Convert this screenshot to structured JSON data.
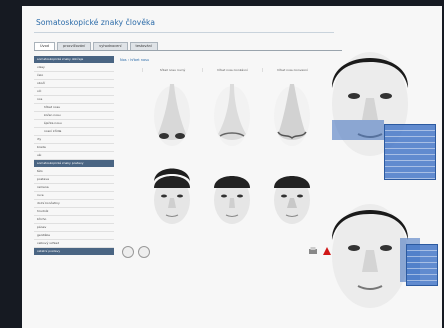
{
  "app": {
    "title": "Somatoskopické znaky člověka"
  },
  "tabs": [
    {
      "label": "Úvod"
    },
    {
      "label": "procvičování"
    },
    {
      "label": "vyhodnocení"
    },
    {
      "label": "testování"
    }
  ],
  "sidebar": {
    "header1": "somatoskopické znaky obličeje",
    "items1": [
      "vlasy",
      "čelo",
      "obočí",
      "oči",
      "nos",
      "hřbet nosu",
      "kořen nosu",
      "špička nosu",
      "nosní křídla",
      "rty",
      "brada",
      "uši"
    ],
    "header2": "somatoskopické znaky postavy",
    "items2": [
      "tělo",
      "postava",
      "ramena",
      "ruce",
      "dolní končetiny",
      "hrudník",
      "břicho",
      "pánev",
      "genitálie",
      "celkový vzhled"
    ],
    "header3": "ostatní postavy"
  },
  "breadcrumb": "Nos › hřbet nosu",
  "columns": [
    "hřbet nosu rovný",
    "hřbet nosu konkávní",
    "hřbet nosu konvexní"
  ],
  "popup_top_rows": [
    "",
    "",
    "",
    "",
    "",
    "",
    "",
    "",
    ""
  ],
  "popup_bottom_rows": [
    "",
    "",
    "",
    "",
    "",
    ""
  ]
}
